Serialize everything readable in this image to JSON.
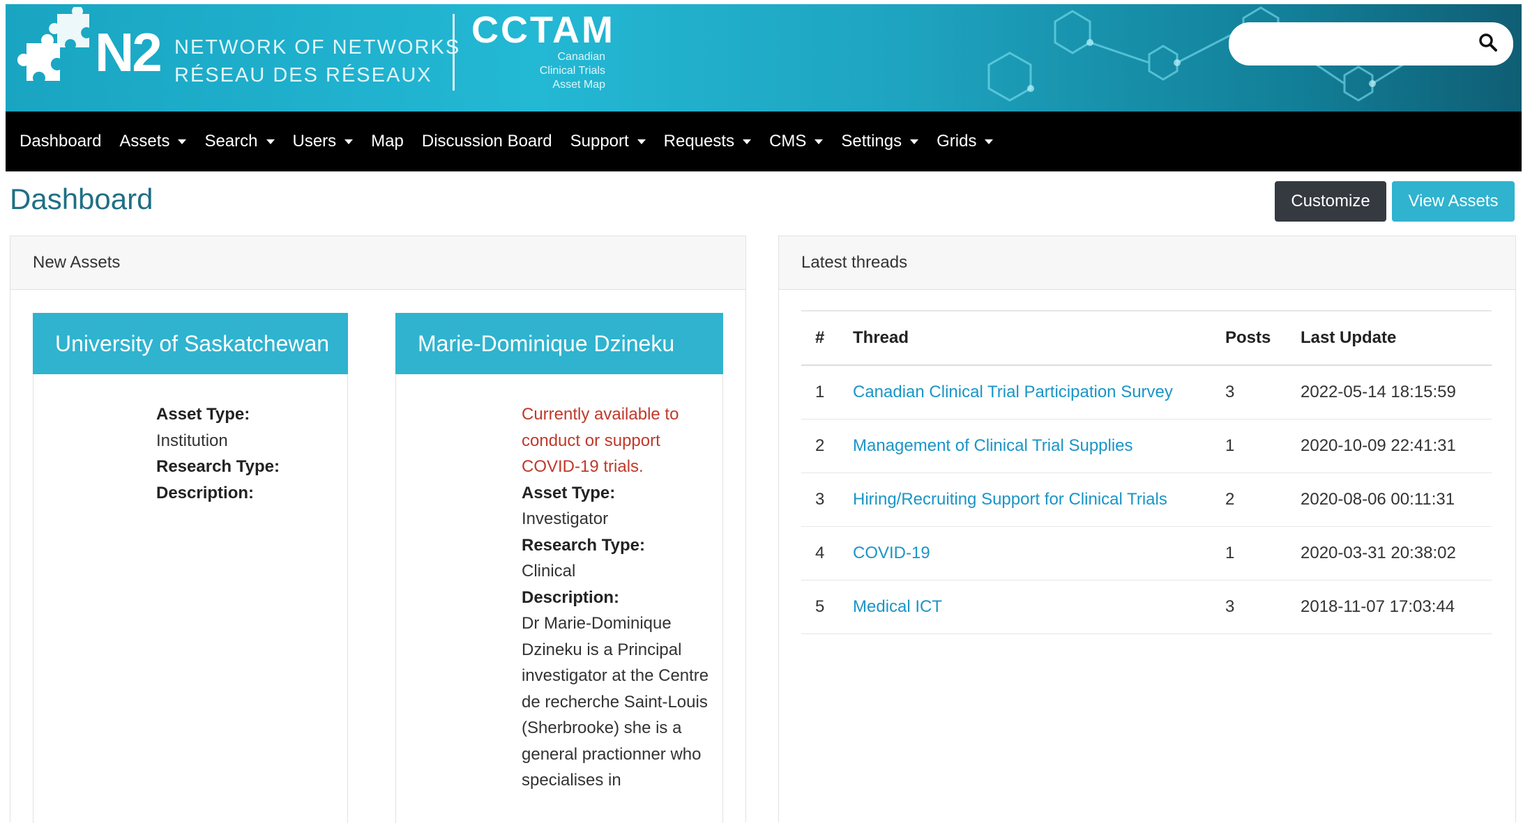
{
  "header": {
    "n2_mark": "N2",
    "network_en": "NETWORK OF NETWORKS",
    "network_fr": "RÉSEAU DES RÉSEAUX",
    "cctam": "CCTAM",
    "cctam_sub": [
      "Canadian",
      "Clinical Trials",
      "Asset Map"
    ],
    "search_placeholder": "",
    "brand_color": "#23b8d4"
  },
  "nav": [
    {
      "label": "Dashboard",
      "dropdown": false
    },
    {
      "label": "Assets",
      "dropdown": true
    },
    {
      "label": "Search",
      "dropdown": true
    },
    {
      "label": "Users",
      "dropdown": true
    },
    {
      "label": "Map",
      "dropdown": false
    },
    {
      "label": "Discussion Board",
      "dropdown": false
    },
    {
      "label": "Support",
      "dropdown": true
    },
    {
      "label": "Requests",
      "dropdown": true
    },
    {
      "label": "CMS",
      "dropdown": true
    },
    {
      "label": "Settings",
      "dropdown": true
    },
    {
      "label": "Grids",
      "dropdown": true
    }
  ],
  "page": {
    "title": "Dashboard",
    "customize_label": "Customize",
    "view_assets_label": "View Assets"
  },
  "new_assets": {
    "header": "New Assets",
    "assets": [
      {
        "name": "University of Saskatchewan",
        "note": "",
        "asset_type_label": "Asset Type:",
        "asset_type": "Institution",
        "research_type_label": "Research Type:",
        "research_type": "",
        "description_label": "Description:",
        "description": ""
      },
      {
        "name": "Marie-Dominique Dzineku",
        "note": "Currently available to conduct or support COVID-19 trials.",
        "asset_type_label": "Asset Type:",
        "asset_type": "Investigator",
        "research_type_label": "Research Type:",
        "research_type": "Clinical",
        "description_label": "Description:",
        "description": "Dr Marie-Dominique Dzineku is a Principal investigator at the Centre de recherche Saint-Louis (Sherbrooke) she is a general practionner who specialises in"
      }
    ]
  },
  "threads": {
    "header": "Latest threads",
    "columns": [
      "#",
      "Thread",
      "Posts",
      "Last Update"
    ],
    "rows": [
      {
        "num": "1",
        "thread": "Canadian Clinical Trial Participation Survey",
        "posts": "3",
        "updated": "2022-05-14 18:15:59"
      },
      {
        "num": "2",
        "thread": "Management of Clinical Trial Supplies",
        "posts": "1",
        "updated": "2020-10-09 22:41:31"
      },
      {
        "num": "3",
        "thread": "Hiring/Recruiting Support for Clinical Trials",
        "posts": "2",
        "updated": "2020-08-06 00:11:31"
      },
      {
        "num": "4",
        "thread": "COVID-19",
        "posts": "1",
        "updated": "2020-03-31 20:38:02"
      },
      {
        "num": "5",
        "thread": "Medical ICT",
        "posts": "3",
        "updated": "2018-11-07 17:03:44"
      }
    ]
  }
}
